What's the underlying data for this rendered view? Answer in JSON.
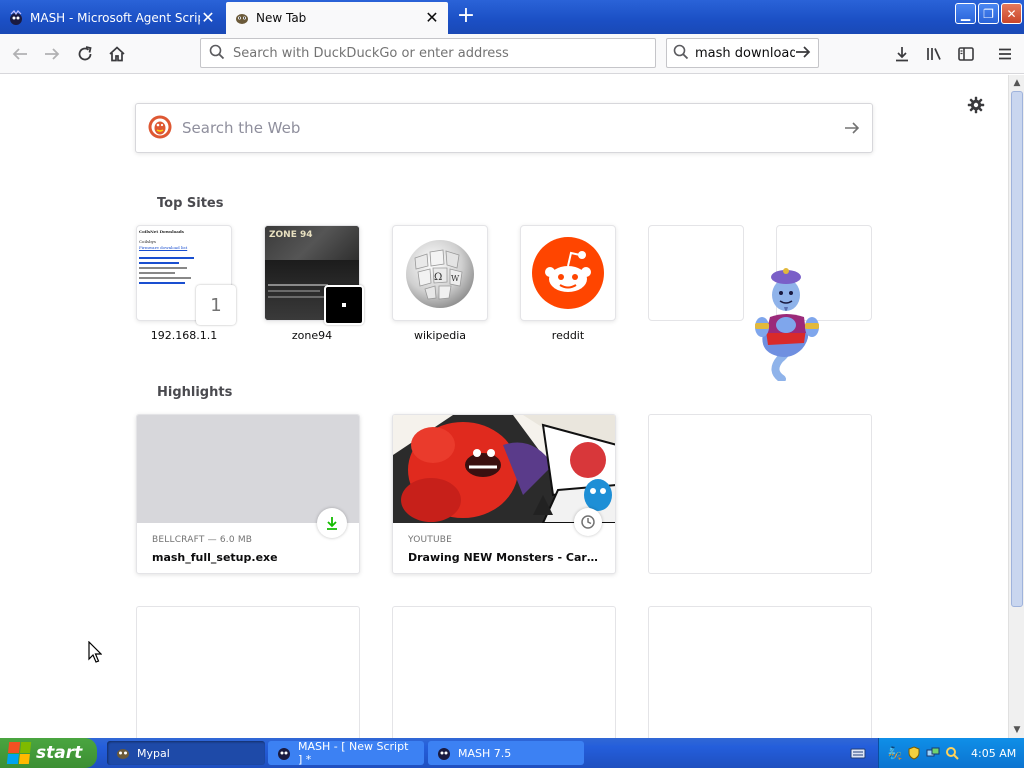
{
  "tabs": [
    {
      "title": "MASH - Microsoft Agent Scripting Helper",
      "active": false
    },
    {
      "title": "New Tab",
      "active": true
    }
  ],
  "toolbar": {
    "url_placeholder": "Search with DuckDuckGo or enter address",
    "search_value": "mash download"
  },
  "newtab": {
    "search_placeholder": "Search the Web",
    "top_sites_title": "Top Sites",
    "top_sites": [
      {
        "label": "192.168.1.1",
        "badge": "1"
      },
      {
        "label": "zone94"
      },
      {
        "label": "wikipedia"
      },
      {
        "label": "reddit"
      },
      {
        "label": ""
      },
      {
        "label": ""
      }
    ],
    "thumb_192": {
      "heading": "CoilsNet Downloads",
      "line1": "Coilsbys",
      "line2": "Firmware download list"
    },
    "highlights_title": "Highlights",
    "highlights": [
      {
        "source": "BELLCRAFT — 6.0 MB",
        "title": "mash_full_setup.exe"
      },
      {
        "source": "YOUTUBE",
        "title": "Drawing NEW Monsters - Cartoo..."
      }
    ]
  },
  "taskbar": {
    "start_label": "start",
    "tasks": [
      {
        "label": "Mypal"
      },
      {
        "label": "MASH - [ New Script ] *"
      },
      {
        "label": "MASH 7.5"
      }
    ],
    "clock": "4:05 AM"
  },
  "colors": {
    "xp_blue": "#245edb",
    "reddit": "#ff4500",
    "download_green": "#12bc00",
    "duckduckgo": "#de5833"
  }
}
